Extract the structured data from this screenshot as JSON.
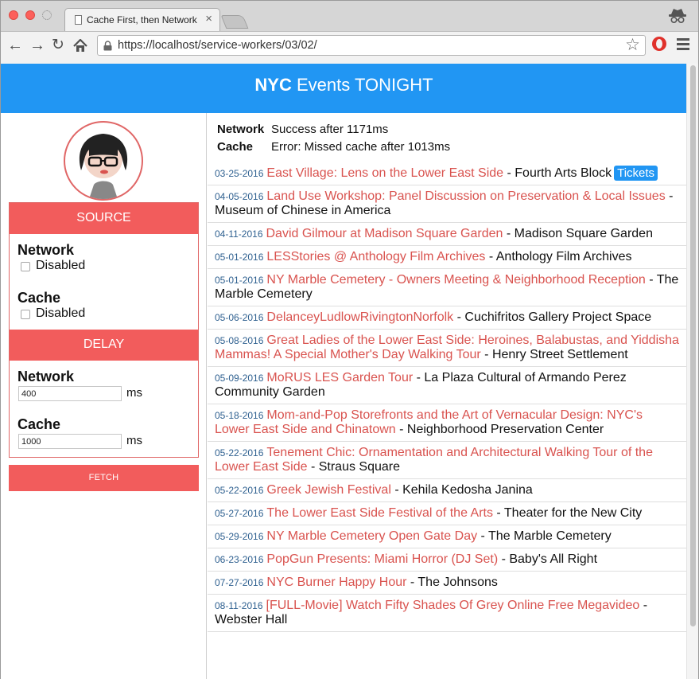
{
  "browser": {
    "tab_title": "Cache First, then Network",
    "tab_close": "×",
    "url": "https://localhost/service-workers/03/02/"
  },
  "header": {
    "title_bold": "NYC",
    "title_rest": " Events TONIGHT"
  },
  "status": {
    "network_label": "Network",
    "network_value": "Success after 1171ms",
    "cache_label": "Cache",
    "cache_value": "Error: Missed cache after 1013ms"
  },
  "sidebar": {
    "source_heading": "SOURCE",
    "source_network_label": "Network",
    "source_network_checkbox": "Disabled",
    "source_cache_label": "Cache",
    "source_cache_checkbox": "Disabled",
    "delay_heading": "DELAY",
    "delay_network_label": "Network",
    "delay_network_value": "400",
    "delay_network_unit": "ms",
    "delay_cache_label": "Cache",
    "delay_cache_value": "1000",
    "delay_cache_unit": "ms",
    "fetch_label": "FETCH"
  },
  "events": [
    {
      "date": "03-25-2016",
      "title": "East Village: Lens on the Lower East Side",
      "venue": " - Fourth Arts Block",
      "tickets": "Tickets"
    },
    {
      "date": "04-05-2016",
      "title": "Land Use Workshop: Panel Discussion on Preservation & Local Issues",
      "venue": " - Museum of Chinese in America"
    },
    {
      "date": "04-11-2016",
      "title": "David Gilmour at Madison Square Garden",
      "venue": " - Madison Square Garden"
    },
    {
      "date": "05-01-2016",
      "title": "LESStories @ Anthology Film Archives",
      "venue": " - Anthology Film Archives"
    },
    {
      "date": "05-01-2016",
      "title": "NY Marble Cemetery - Owners Meeting & Neighborhood Reception",
      "venue": " - The Marble Cemetery"
    },
    {
      "date": "05-06-2016",
      "title": "DelanceyLudlowRivingtonNorfolk",
      "venue": " - Cuchifritos Gallery Project Space"
    },
    {
      "date": "05-08-2016",
      "title": "Great Ladies of the Lower East Side: Heroines, Balabustas, and Yiddisha Mammas! A Special Mother's Day Walking Tour",
      "venue": " - Henry Street Settlement"
    },
    {
      "date": "05-09-2016",
      "title": "MoRUS LES Garden Tour",
      "venue": " - La Plaza Cultural of Armando Perez Community Garden"
    },
    {
      "date": "05-18-2016",
      "title": "Mom-and-Pop Storefronts and the Art of Vernacular Design: NYC's Lower East Side and Chinatown",
      "venue": " - Neighborhood Preservation Center"
    },
    {
      "date": "05-22-2016",
      "title": "Tenement Chic: Ornamentation and Architectural Walking Tour of the Lower East Side",
      "venue": " - Straus Square"
    },
    {
      "date": "05-22-2016",
      "title": "Greek Jewish Festival",
      "venue": " - Kehila Kedosha Janina"
    },
    {
      "date": "05-27-2016",
      "title": "The Lower East Side Festival of the Arts",
      "venue": " - Theater for the New City"
    },
    {
      "date": "05-29-2016",
      "title": "NY Marble Cemetery Open Gate Day",
      "venue": " - The Marble Cemetery"
    },
    {
      "date": "06-23-2016",
      "title": "PopGun Presents: Miami Horror (DJ Set)",
      "venue": " - Baby's All Right"
    },
    {
      "date": "07-27-2016",
      "title": "NYC Burner Happy Hour",
      "venue": " - The Johnsons"
    },
    {
      "date": "08-11-2016",
      "title": "[FULL-Movie] Watch Fifty Shades Of Grey Online Free Megavideo",
      "venue": " - Webster Hall"
    }
  ]
}
